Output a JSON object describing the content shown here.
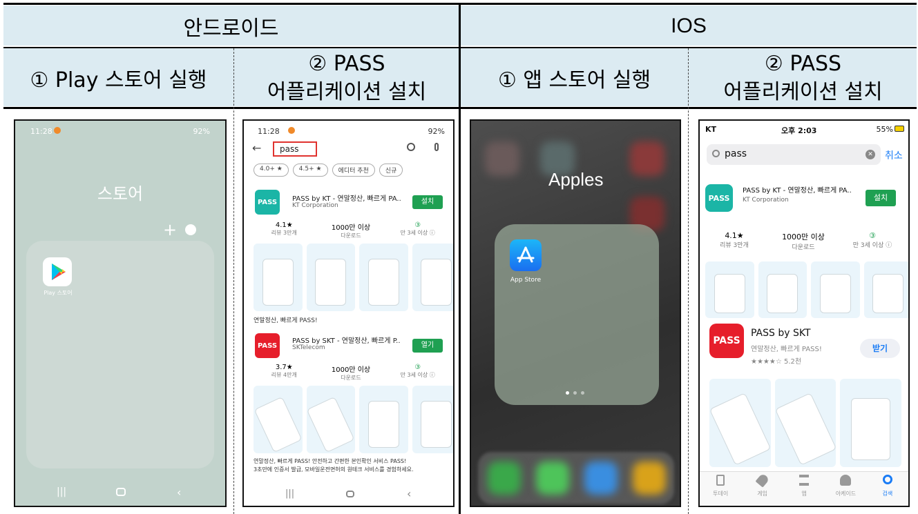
{
  "header": {
    "android": "안드로이드",
    "ios": "IOS",
    "android_step1": "① Play 스토어 실행",
    "android_step2_line1": "② PASS",
    "android_step2_line2": "어플리케이션 설치",
    "ios_step1": "① 앱 스토어 실행",
    "ios_step2_line1": "② PASS",
    "ios_step2_line2": "어플리케이션 설치"
  },
  "screen_a": {
    "time": "11:28",
    "status_right": "92%",
    "folder_title": "스토어",
    "plus": "+",
    "app_label": "Play 스토어"
  },
  "screen_b": {
    "time": "11:28",
    "status_right": "92%",
    "search_value": "pass",
    "chips": [
      "4.0+ ★",
      "4.5+ ★",
      "에디터 추천",
      "신규"
    ],
    "app1": {
      "icon_text": "PASS",
      "title": "PASS by KT - 연말정산, 빠르게 PA..",
      "publisher": "KT Corporation",
      "button": "설치",
      "rating": "4.1★",
      "rating_sub": "리뷰 3만개",
      "downloads": "1000만 이상",
      "downloads_sub": "다운로드",
      "age": "③",
      "age_sub": "만 3세 이상 ⓘ",
      "caption": "연말정산, 빠르게 PASS!"
    },
    "app2": {
      "icon_text": "PASS",
      "title": "PASS by SKT - 연말정산, 빠르게 P..",
      "publisher": "SKTelecom",
      "button": "열기",
      "rating": "3.7★",
      "rating_sub": "리뷰 4만개",
      "downloads": "1000만 이상",
      "downloads_sub": "다운로드",
      "age": "③",
      "age_sub": "만 3세 이상 ⓘ",
      "caption_line1": "연말정산, 빠르게 PASS! 안전하고 간편한 본인확인 서비스 PASS!",
      "caption_line2": "3초만에 인증서 발급, 모바일운전면허의 원테크 서비스를 경험하세요."
    }
  },
  "screen_c": {
    "folder_title": "Apples",
    "app_label": "App Store"
  },
  "screen_d": {
    "carrier": "KT",
    "time": "오후 2:03",
    "battery": "55%",
    "search_value": "pass",
    "cancel": "취소",
    "app1": {
      "icon_text": "PASS",
      "title": "PASS by KT - 연말정산, 빠르게 PA..",
      "publisher": "KT Corporation",
      "button": "설치",
      "rating": "4.1★",
      "rating_sub": "리뷰 3만개",
      "downloads": "1000만 이상",
      "downloads_sub": "다운로드",
      "age": "③",
      "age_sub": "만 3세 이상 ⓘ"
    },
    "app2": {
      "icon_text": "PASS",
      "title": "PASS by SKT",
      "subtitle": "연말정산, 빠르게 PASS!",
      "stars": "★★★★☆ 5.2천",
      "button": "받기"
    },
    "tabs": [
      "투데이",
      "게임",
      "앱",
      "아케이드",
      "검색"
    ]
  },
  "colors": {
    "header_bg": "#dcebf2",
    "play_green": "#1fa052",
    "pass_teal": "#1bb5a6",
    "pass_red": "#e61e2b",
    "ios_blue": "#1a7cf5"
  }
}
